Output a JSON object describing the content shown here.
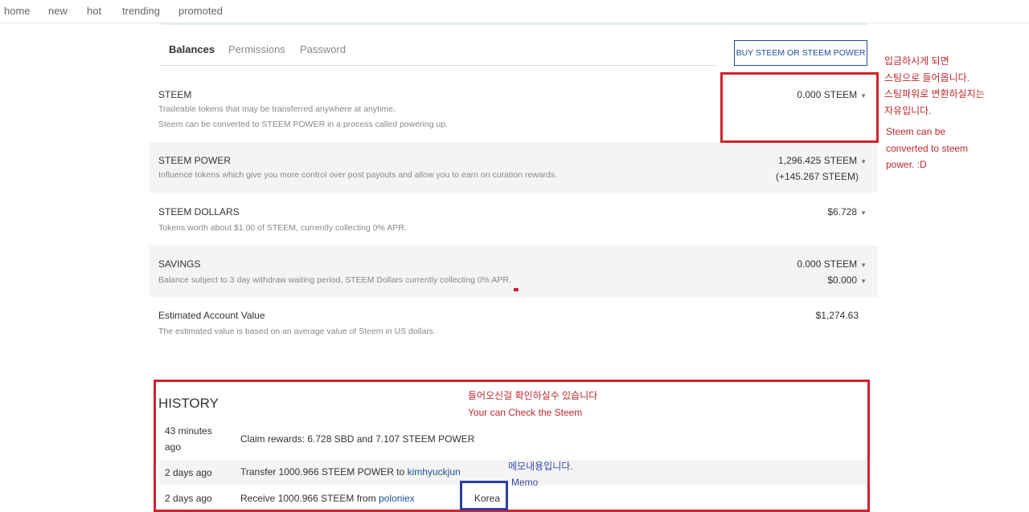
{
  "nav": {
    "items": [
      "home",
      "new",
      "hot",
      "trending",
      "promoted"
    ]
  },
  "tabs": [
    "Balances",
    "Permissions",
    "Password"
  ],
  "buy_button": "BUY STEEM OR STEEM POWER",
  "balances": {
    "steem": {
      "title": "STEEM",
      "desc1": "Tradeable tokens that may be transferred anywhere at anytime.",
      "desc2": "Steem can be converted to STEEM POWER in a process called powering up.",
      "value": "0.000 STEEM"
    },
    "steem_power": {
      "title": "STEEM POWER",
      "desc": "Influence tokens which give you more control over post payouts and allow you to earn on curation rewards.",
      "value": "1,296.425 STEEM",
      "delegated": "(+145.267 STEEM)"
    },
    "steem_dollars": {
      "title": "STEEM DOLLARS",
      "desc": "Tokens worth about $1.00 of STEEM, currently collecting 0% APR.",
      "value": "$6.728"
    },
    "savings": {
      "title": "SAVINGS",
      "desc": "Balance subject to 3 day withdraw waiting period, STEEM Dollars currently collecting 0% APR.",
      "value_steem": "0.000 STEEM",
      "value_sbd": "$0.000"
    },
    "estimated": {
      "title": "Estimated Account Value",
      "desc": "The estimated value is based on an average value of Steem in US dollars.",
      "value": "$1,274.63"
    }
  },
  "history": {
    "title": "HISTORY",
    "rows": [
      {
        "when_line1": "43 minutes",
        "when_line2": "ago",
        "text": "Claim rewards: 6.728 SBD and 7.107 STEEM POWER"
      },
      {
        "when": "2 days ago",
        "text": "Transfer 1000.966 STEEM POWER to ",
        "link": "kimhyuckjun"
      },
      {
        "when": "2 days ago",
        "text": "Receive 1000.966 STEEM from ",
        "link": "poloniex",
        "memo": "Korea"
      }
    ]
  },
  "annotations": {
    "steem_note_ko": [
      "입금하시게 되면",
      "스팀으로 들어옵니다.",
      "스팀파워로 변환하실지는",
      "자유입니다."
    ],
    "steem_note_en": [
      "Steem can be",
      "converted to steem",
      "power. :D"
    ],
    "history_note_ko": "들어오신걸 확인하실수 있습니다",
    "history_note_en": "Your can Check the Steem",
    "memo_note_ko": "메모내용입니다.",
    "memo_note_en": "Memo"
  },
  "colors": {
    "annotation_red": "#d0232b",
    "annotation_blue": "#2c3ea4",
    "link_blue": "#1a5099"
  }
}
